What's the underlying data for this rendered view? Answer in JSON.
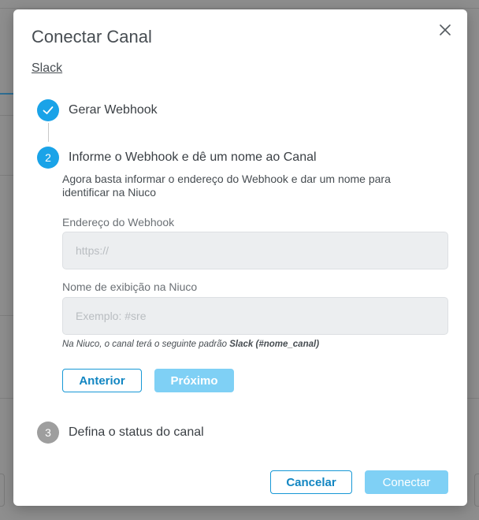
{
  "modal": {
    "title": "Conectar Canal",
    "channel_link": "Slack",
    "close_icon": "close-icon"
  },
  "steps": [
    {
      "number": "1",
      "label": "Gerar Webhook",
      "state": "done",
      "icon": "check-icon"
    },
    {
      "number": "2",
      "label": "Informe o Webhook e dê um nome ao Canal",
      "state": "active"
    },
    {
      "number": "3",
      "label": "Defina o status do canal",
      "state": "pending"
    }
  ],
  "step2": {
    "description": "Agora basta informar o endereço do Webhook e dar um nome para identificar na Niuco",
    "webhook_label": "Endereço do Webhook",
    "webhook_placeholder": "https://",
    "webhook_value": "",
    "name_label": "Nome de exibição na Niuco",
    "name_placeholder": "Exemplo: #sre",
    "name_value": "",
    "hint_prefix": "Na Niuco, o canal terá o seguinte padrão ",
    "hint_pattern": "Slack (#nome_canal)",
    "prev_button": "Anterior",
    "next_button": "Próximo"
  },
  "footer": {
    "cancel_button": "Cancelar",
    "connect_button": "Conectar"
  },
  "colors": {
    "accent": "#1aa3e8",
    "accent_disabled": "#7fd0f5",
    "inactive_step": "#9e9e9e",
    "overlay": "#8e8e8e"
  }
}
